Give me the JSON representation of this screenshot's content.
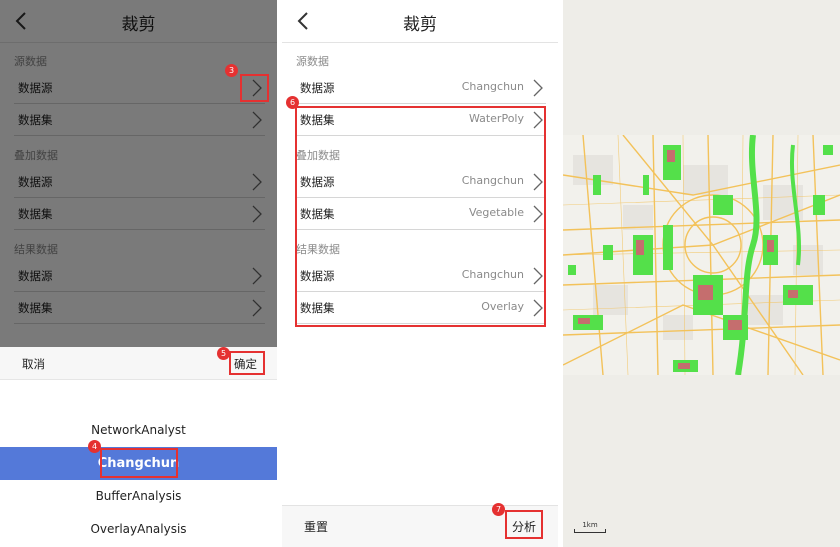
{
  "header": {
    "title": "裁剪"
  },
  "sections": {
    "source": "源数据",
    "overlay": "叠加数据",
    "result": "结果数据"
  },
  "labels": {
    "datasource": "数据源",
    "dataset": "数据集"
  },
  "panel1": {
    "picker": {
      "cancel": "取消",
      "confirm": "确定",
      "options": [
        "NetworkAnalyst",
        "Changchun",
        "BufferAnalysis",
        "OverlayAnalysis"
      ],
      "selected": "Changchun"
    }
  },
  "panel2": {
    "source_datasource": "Changchun",
    "source_dataset": "WaterPoly",
    "overlay_datasource": "Changchun",
    "overlay_dataset": "Vegetable",
    "result_datasource": "Changchun",
    "result_dataset": "Overlay",
    "reset": "重置",
    "analyze": "分析"
  },
  "map": {
    "scale": "1km"
  },
  "badges": [
    "3",
    "4",
    "5",
    "6",
    "7"
  ],
  "colors": {
    "accent": "#5479d9",
    "highlight": "#e53131",
    "vegetation": "#54e04a",
    "water": "#c56e6e",
    "roads": "#f3c25a"
  }
}
